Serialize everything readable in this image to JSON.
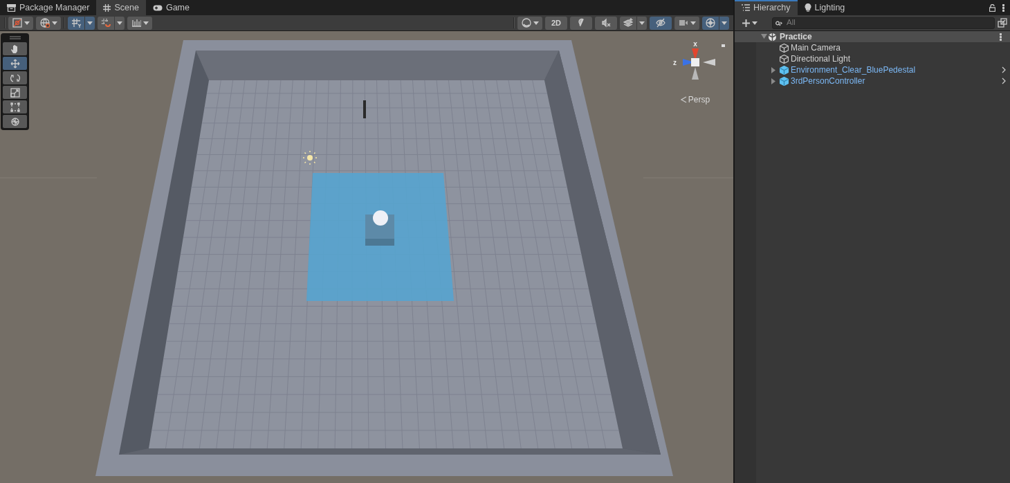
{
  "scene_panel": {
    "tabs": [
      {
        "label": "Package Manager",
        "selected": false
      },
      {
        "label": "Scene",
        "selected": true
      },
      {
        "label": "Game",
        "selected": false
      }
    ]
  },
  "scene_toolbar": {
    "left": [
      {
        "selected": false,
        "dropdown": true,
        "split": false
      },
      {
        "selected": false,
        "dropdown": true,
        "split": false
      },
      {
        "selected": true,
        "dropdown": true,
        "split": true
      },
      {
        "selected": false,
        "dropdown": true,
        "split": true
      },
      {
        "selected": false,
        "dropdown": true,
        "split": false
      }
    ],
    "right": [
      {
        "selected": false,
        "dropdown": true,
        "split": false
      },
      {
        "label": "2D",
        "selected": false,
        "dropdown": false,
        "split": false
      },
      {
        "selected": false,
        "dropdown": false,
        "split": false
      },
      {
        "selected": false,
        "dropdown": false,
        "split": false
      },
      {
        "selected": false,
        "dropdown": true,
        "split": true
      },
      {
        "selected": true,
        "dropdown": false,
        "split": false
      },
      {
        "selected": false,
        "dropdown": true,
        "split": false
      },
      {
        "selected": true,
        "dropdown": true,
        "split": true
      }
    ]
  },
  "tools": [
    {
      "selected": false
    },
    {
      "selected": true
    },
    {
      "selected": false
    },
    {
      "selected": false
    },
    {
      "selected": false
    },
    {
      "selected": false
    }
  ],
  "gizmo": {
    "x_label": "x",
    "z_label": "z",
    "projection": "Persp"
  },
  "hierarchy_panel": {
    "tabs": [
      {
        "label": "Hierarchy",
        "selected": true
      },
      {
        "label": "Lighting",
        "selected": false
      }
    ],
    "search": {
      "placeholder": "All"
    },
    "scene": {
      "name": "Practice",
      "expanded": true,
      "children": [
        {
          "name": "Main Camera",
          "kind": "gameobject",
          "expanded": false,
          "has_children": false
        },
        {
          "name": "Directional Light",
          "kind": "gameobject",
          "expanded": false,
          "has_children": false
        },
        {
          "name": "Environment_Clear_BluePedestal",
          "kind": "prefab",
          "expanded": false,
          "has_children": true
        },
        {
          "name": "3rdPersonController",
          "kind": "prefab",
          "expanded": false,
          "has_children": true
        }
      ]
    }
  }
}
